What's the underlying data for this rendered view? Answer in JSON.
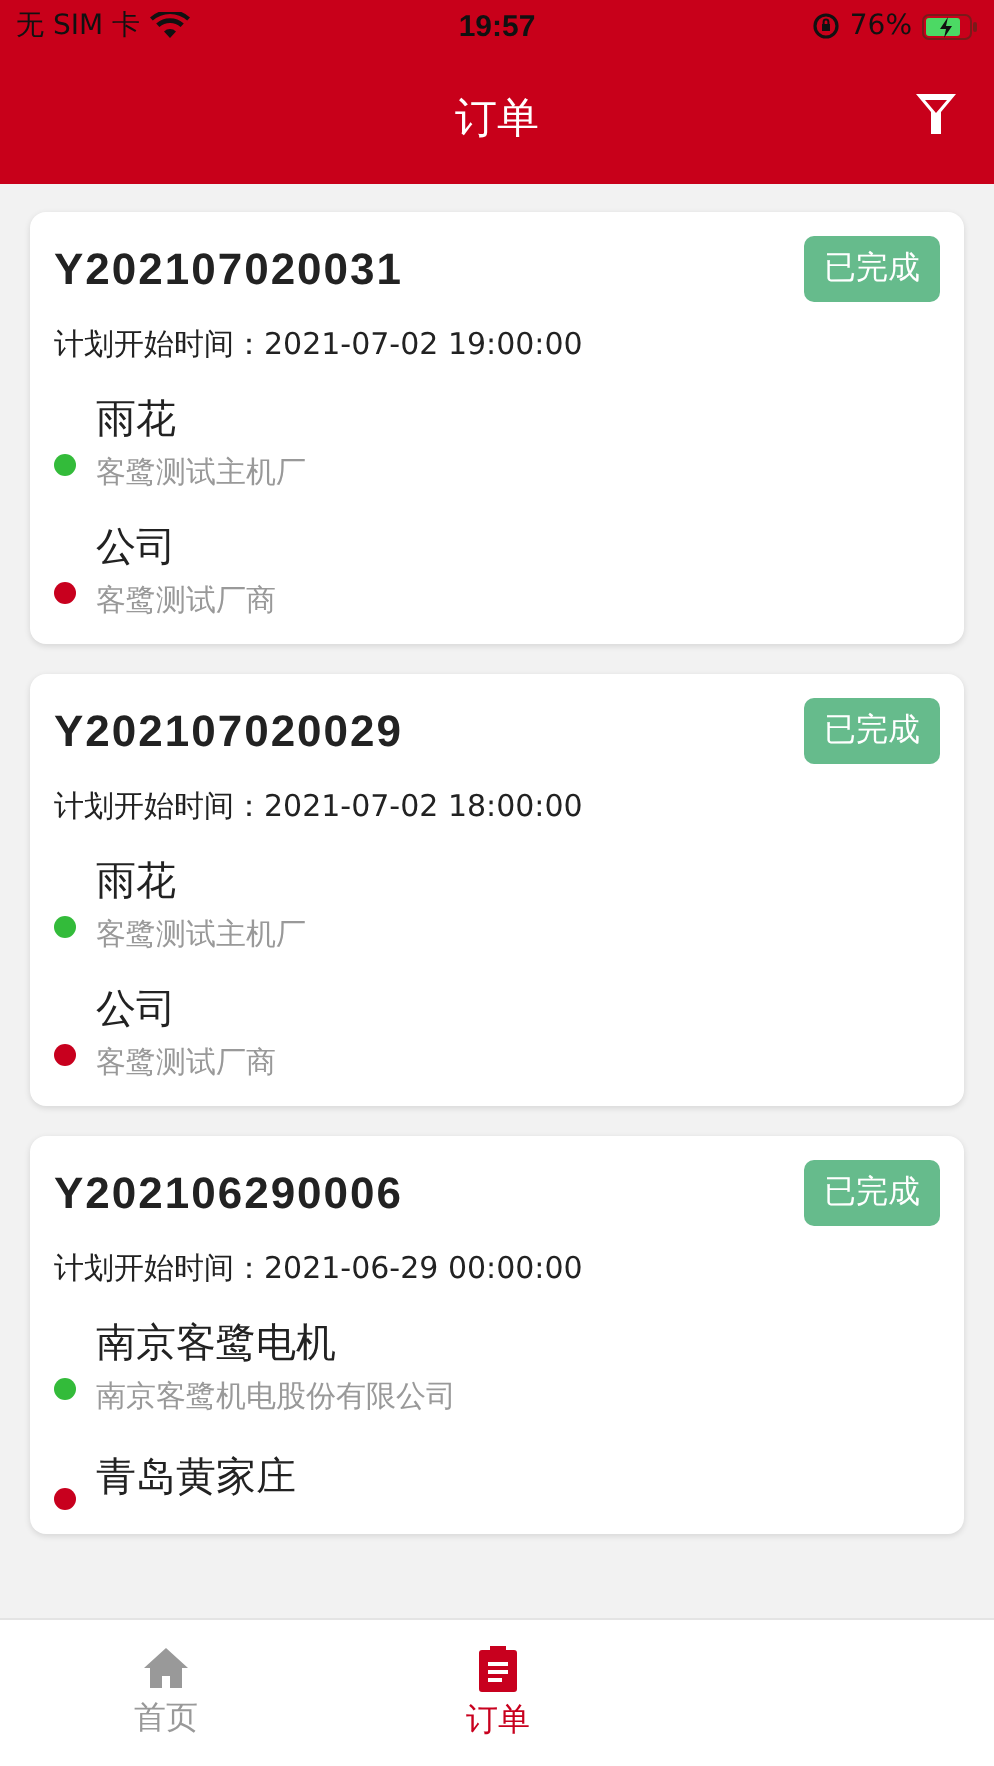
{
  "status_bar": {
    "carrier": "无 SIM 卡",
    "time": "19:57",
    "battery": "76%"
  },
  "header": {
    "title": "订单"
  },
  "orders": [
    {
      "id": "Y202107020031",
      "status": "已完成",
      "time_label": "计划开始时间：",
      "time": "2021-07-02 19:00:00",
      "stops": [
        {
          "name": "雨花",
          "company": "客鹭测试主机厂",
          "color": "#33bb3a"
        },
        {
          "name": "公司",
          "company": "客鹭测试厂商",
          "color": "#c8001e"
        }
      ]
    },
    {
      "id": "Y202107020029",
      "status": "已完成",
      "time_label": "计划开始时间：",
      "time": "2021-07-02 18:00:00",
      "stops": [
        {
          "name": "雨花",
          "company": "客鹭测试主机厂",
          "color": "#33bb3a"
        },
        {
          "name": "公司",
          "company": "客鹭测试厂商",
          "color": "#c8001e"
        }
      ]
    },
    {
      "id": "Y202106290006",
      "status": "已完成",
      "time_label": "计划开始时间：",
      "time": "2021-06-29 00:00:00",
      "stops": [
        {
          "name": "南京客鹭电机",
          "company": "南京客鹭机电股份有限公司",
          "color": "#33bb3a"
        },
        {
          "name": "青岛黄家庄",
          "color": "#c8001e"
        }
      ]
    }
  ],
  "tab_bar": [
    {
      "kind": "home",
      "label": "首页",
      "selected": false
    },
    {
      "kind": "orders",
      "label": "订单",
      "selected": true
    }
  ]
}
